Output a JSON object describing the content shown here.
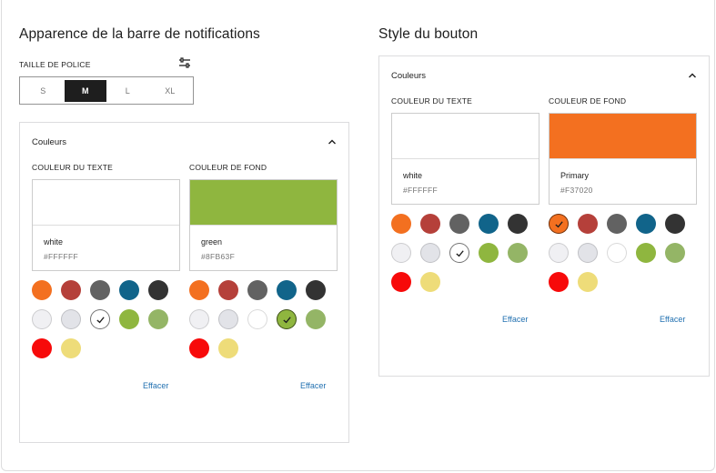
{
  "left": {
    "title": "Apparence de la barre de notifications",
    "font_size": {
      "label": "TAILLE DE POLICE",
      "icon": "sliders-icon",
      "options": [
        "S",
        "M",
        "L",
        "XL"
      ],
      "selected": "M"
    },
    "panel": {
      "title": "Couleurs",
      "text_color": {
        "label": "COULEUR DU TEXTE",
        "name": "white",
        "hex": "#FFFFFF",
        "selected_index": 7,
        "clear_label": "Effacer"
      },
      "background_color": {
        "label": "COULEUR DE FOND",
        "name": "green",
        "hex": "#8FB63F",
        "selected_index": 8,
        "clear_label": "Effacer"
      }
    }
  },
  "right": {
    "title": "Style du bouton",
    "panel": {
      "title": "Couleurs",
      "text_color": {
        "label": "COULEUR DU TEXTE",
        "name": "white",
        "hex": "#FFFFFF",
        "selected_index": 7,
        "clear_label": "Effacer"
      },
      "background_color": {
        "label": "COULEUR DE FOND",
        "name": "Primary",
        "hex": "#F37020",
        "selected_index": 0,
        "clear_label": "Effacer"
      }
    }
  },
  "palette": [
    "#F37020",
    "#B5403A",
    "#626262",
    "#11648A",
    "#333333",
    "#F0F0F3",
    "#E2E3E8",
    "#FFFFFF",
    "#8FB63F",
    "#94B566",
    "#F70A0A",
    "#EEDC79"
  ],
  "colors": {
    "link": "#2271b1",
    "active_segment": "#1e1e1e"
  }
}
